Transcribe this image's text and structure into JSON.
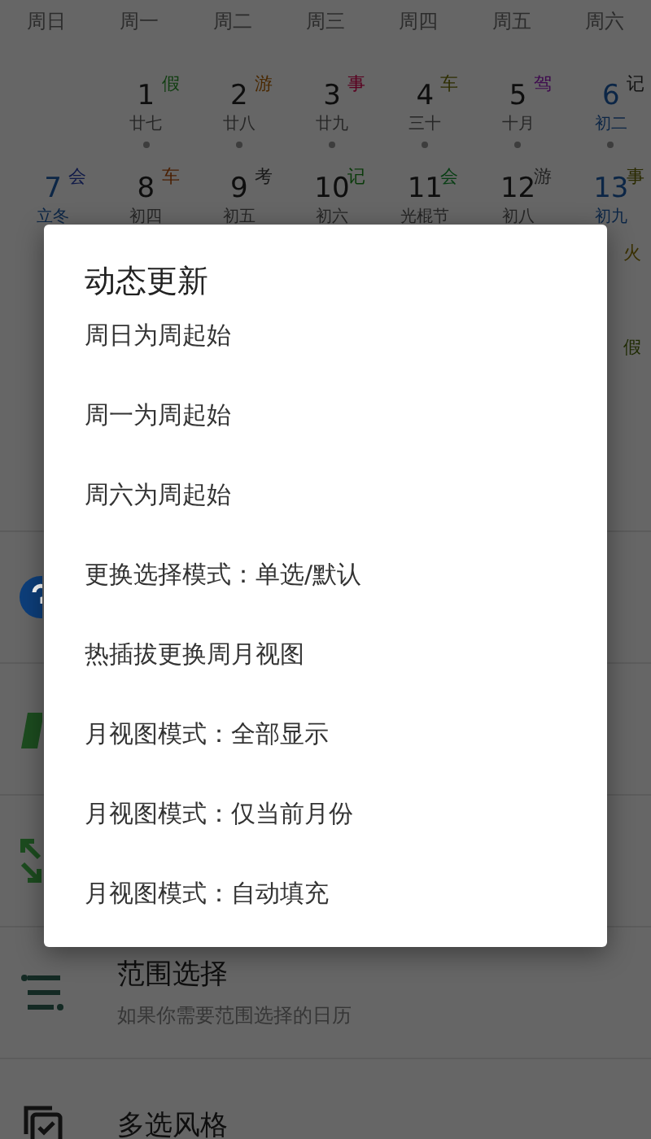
{
  "weekdays": [
    "周日",
    "周一",
    "周二",
    "周三",
    "周四",
    "周五",
    "周六"
  ],
  "calendar_rows": [
    [
      null,
      {
        "day": "1",
        "lunar": "廿七",
        "mark": "假",
        "color": "#0f3d0f",
        "weekend": false,
        "dot": true
      },
      {
        "day": "2",
        "lunar": "廿八",
        "mark": "游",
        "color": "#4a2800",
        "weekend": false,
        "dot": true
      },
      {
        "day": "3",
        "lunar": "廿九",
        "mark": "事",
        "color": "#5a0020",
        "weekend": false,
        "dot": true
      },
      {
        "day": "4",
        "lunar": "三十",
        "mark": "车",
        "color": "#2e2e00",
        "weekend": false,
        "dot": true
      },
      {
        "day": "5",
        "lunar": "十月",
        "mark": "驾",
        "color": "#3e0a4e",
        "weekend": false,
        "dot": true
      },
      {
        "day": "6",
        "lunar": "初二",
        "mark": "记",
        "color": "#111111",
        "weekend": true,
        "dot": true
      }
    ],
    [
      {
        "day": "7",
        "lunar": "立冬",
        "mark": "会",
        "color": "#101a48",
        "weekend": true,
        "dot": false
      },
      {
        "day": "8",
        "lunar": "初四",
        "mark": "车",
        "color": "#4a1e00",
        "weekend": false,
        "dot": false
      },
      {
        "day": "9",
        "lunar": "初五",
        "mark": "考",
        "color": "#1a1a1a",
        "weekend": false,
        "dot": false
      },
      {
        "day": "10",
        "lunar": "初六",
        "mark": "记",
        "color": "#0a3a0a",
        "weekend": false,
        "dot": false
      },
      {
        "day": "11",
        "lunar": "光棍节",
        "mark": "会",
        "color": "#083e14",
        "weekend": false,
        "dot": false
      },
      {
        "day": "12",
        "lunar": "初八",
        "mark": "游",
        "color": "#222222",
        "weekend": false,
        "dot": false
      },
      {
        "day": "13",
        "lunar": "初九",
        "mark": "事",
        "color": "#2a2a00",
        "weekend": true,
        "dot": false
      }
    ]
  ],
  "edge_marks": [
    {
      "text": "火",
      "color": "#3a3000"
    },
    {
      "text": "假",
      "color": "#1e2a00"
    }
  ],
  "list_items": [
    {
      "kind": "info"
    },
    {
      "kind": "letter"
    },
    {
      "kind": "expand"
    },
    {
      "kind": "range",
      "title": "范围选择",
      "subtitle": "如果你需要范围选择的日历"
    },
    {
      "kind": "multi",
      "title": "多选风格"
    }
  ],
  "dialog": {
    "title": "动态更新",
    "items": [
      "周日为周起始",
      "周一为周起始",
      "周六为周起始",
      "更换选择模式：单选/默认",
      "热插拔更换周月视图",
      "月视图模式：全部显示",
      "月视图模式：仅当前月份",
      "月视图模式：自动填充"
    ]
  }
}
